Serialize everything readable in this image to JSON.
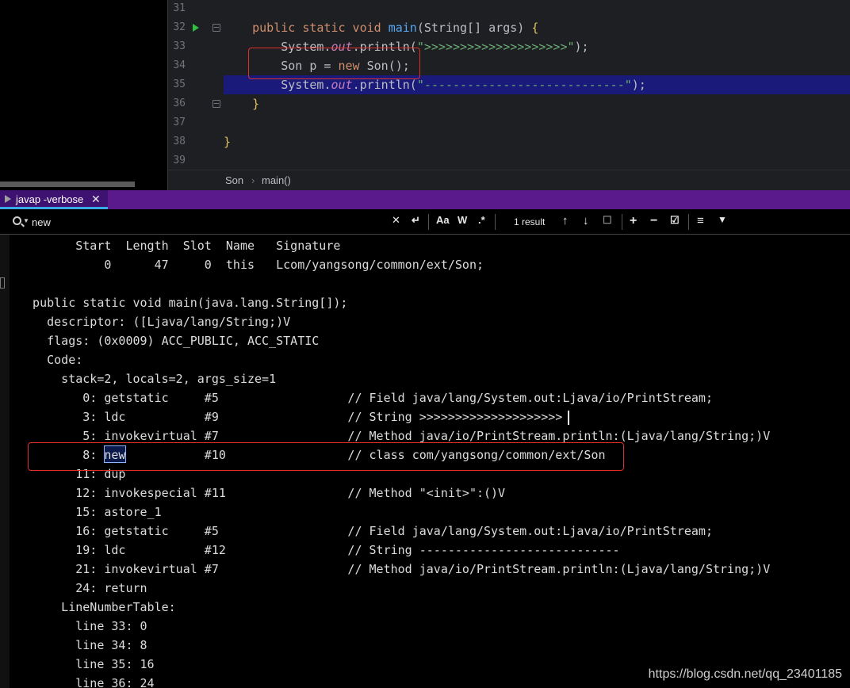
{
  "editor": {
    "line_numbers": [
      "31",
      "32",
      "33",
      "34",
      "35",
      "36",
      "37",
      "38",
      "39"
    ],
    "lines": [
      {
        "ln": "31",
        "tokens": []
      },
      {
        "ln": "32",
        "tokens": [
          {
            "t": "    ",
            "c": "tx"
          },
          {
            "t": "public static void ",
            "c": "kw"
          },
          {
            "t": "main",
            "c": "fn"
          },
          {
            "t": "(String[] args) ",
            "c": "tx"
          },
          {
            "t": "{",
            "c": "br1"
          }
        ]
      },
      {
        "ln": "33",
        "tokens": [
          {
            "t": "        System.",
            "c": "tx"
          },
          {
            "t": "out",
            "c": "fld"
          },
          {
            "t": ".println(",
            "c": "tx"
          },
          {
            "t": "\">>>>>>>>>>>>>>>>>>>>\"",
            "c": "st"
          },
          {
            "t": ");",
            "c": "tx"
          }
        ]
      },
      {
        "ln": "34",
        "tokens": [
          {
            "t": "        Son p = ",
            "c": "tx"
          },
          {
            "t": "new ",
            "c": "kw"
          },
          {
            "t": "Son();",
            "c": "tx"
          }
        ]
      },
      {
        "ln": "35",
        "tokens": [
          {
            "t": "        System.",
            "c": "tx"
          },
          {
            "t": "out",
            "c": "fld"
          },
          {
            "t": ".println(",
            "c": "tx"
          },
          {
            "t": "\"----------------------------\"",
            "c": "st"
          },
          {
            "t": ");",
            "c": "tx"
          }
        ]
      },
      {
        "ln": "36",
        "tokens": [
          {
            "t": "    ",
            "c": "tx"
          },
          {
            "t": "}",
            "c": "br1"
          }
        ]
      },
      {
        "ln": "37",
        "tokens": []
      },
      {
        "ln": "38",
        "tokens": [
          {
            "t": "}",
            "c": "br1"
          }
        ]
      },
      {
        "ln": "39",
        "tokens": []
      }
    ],
    "caret_line": "35",
    "breadcrumb": {
      "class": "Son",
      "separator": "›",
      "method": "main()"
    }
  },
  "toolwindow": {
    "tab_label": "javap -verbose",
    "tab_close": "✕",
    "accent": "#5a1a8c"
  },
  "search": {
    "query": "new",
    "placeholder": "",
    "clear_glyph": "✕",
    "result_count": "1 result",
    "buttons": {
      "newline": "↵",
      "match_case": "Aa",
      "words": "W",
      "regex": ".*",
      "prev": "↑",
      "next": "↓",
      "select_all": "☐",
      "add_occurrence": "+",
      "remove_occurrence": "−",
      "exclude": "☑",
      "multiline": "≡",
      "filter": "▼"
    }
  },
  "console": {
    "lines": [
      "        Start  Length  Slot  Name   Signature",
      "            0      47     0  this   Lcom/yangsong/common/ext/Son;",
      "",
      "  public static void main(java.lang.String[]);",
      "    descriptor: ([Ljava/lang/String;)V",
      "    flags: (0x0009) ACC_PUBLIC, ACC_STATIC",
      "    Code:",
      "      stack=2, locals=2, args_size=1",
      "         0: getstatic     #5                  // Field java/lang/System.out:Ljava/io/PrintStream;",
      "         3: ldc           #9                  // String >>>>>>>>>>>>>>>>>>>>",
      "         5: invokevirtual #7                  // Method java/io/PrintStream.println:(Ljava/lang/String;)V",
      "         8: new           #10                 // class com/yangsong/common/ext/Son",
      "        11: dup",
      "        12: invokespecial #11                 // Method \"<init>\":()V",
      "        15: astore_1",
      "        16: getstatic     #5                  // Field java/lang/System.out:Ljava/io/PrintStream;",
      "        19: ldc           #12                 // String ----------------------------",
      "        21: invokevirtual #7                  // Method java/io/PrintStream.println:(Ljava/lang/String;)V",
      "        24: return",
      "      LineNumberTable:",
      "        line 33: 0",
      "        line 34: 8",
      "        line 35: 16",
      "        line 36: 24"
    ]
  },
  "watermark": "https://blog.csdn.net/qq_23401185"
}
